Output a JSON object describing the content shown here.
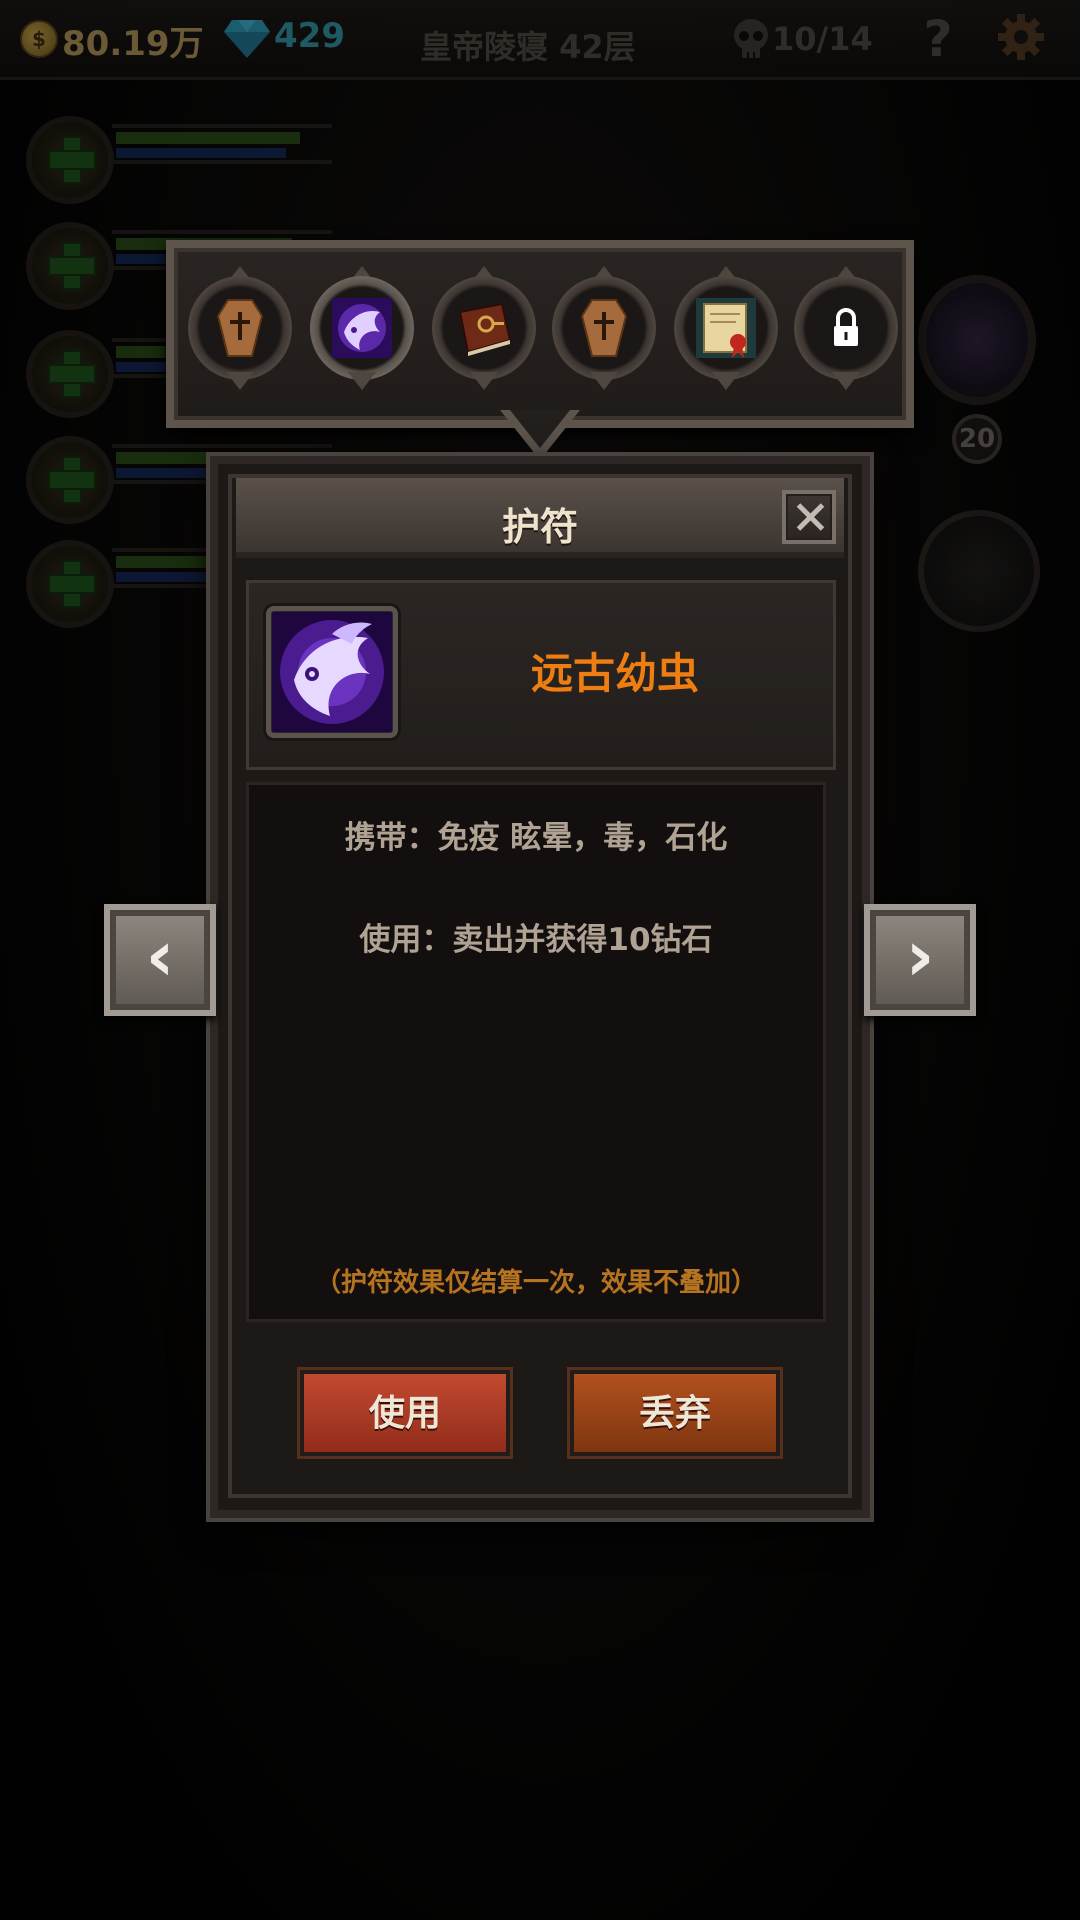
{
  "topbar": {
    "coin_symbol": "$",
    "gold": "80.19万",
    "gems": "429",
    "floor": "皇帝陵寝 42层",
    "kills": "10/14",
    "help_label": "?",
    "coin_icon": "gold-coin-icon",
    "gem_icon": "diamond-icon",
    "skull_icon": "skull-icon",
    "settings_icon": "gear-icon"
  },
  "heroes": [
    {
      "hp_fraction": 0.92,
      "mp_fraction": 0.85
    },
    {
      "hp_fraction": 0.88,
      "mp_fraction": 0.7
    },
    {
      "hp_fraction": 0.85,
      "mp_fraction": 0.68
    },
    {
      "hp_fraction": 0.83,
      "mp_fraction": 0.68
    },
    {
      "hp_fraction": 0.8,
      "mp_fraction": 0.65
    }
  ],
  "character": {
    "level": "20"
  },
  "amulet_tray": {
    "slots": [
      {
        "icon": "coffin-icon",
        "selected": false
      },
      {
        "icon": "ancient-larva-icon",
        "selected": true
      },
      {
        "icon": "red-book-icon",
        "selected": false
      },
      {
        "icon": "coffin-icon",
        "selected": false
      },
      {
        "icon": "scroll-seal-icon",
        "selected": false
      },
      {
        "icon": "lock-icon",
        "selected": false,
        "locked": true
      }
    ]
  },
  "panel": {
    "title": "护符",
    "item_name": "远古幼虫",
    "carry_text": "携带：免疫 眩晕，毒，石化",
    "use_text": "使用：卖出并获得10钻石",
    "note_text": "（护符效果仅结算一次，效果不叠加）",
    "use_button": "使用",
    "drop_button": "丢弃",
    "prev_label": "‹",
    "next_label": "›"
  },
  "colors": {
    "item_name": "#ef7e12",
    "note": "#b77420",
    "use_button": "#c24a30",
    "drop_button": "#b2501e",
    "gem": "#2f8a99"
  }
}
